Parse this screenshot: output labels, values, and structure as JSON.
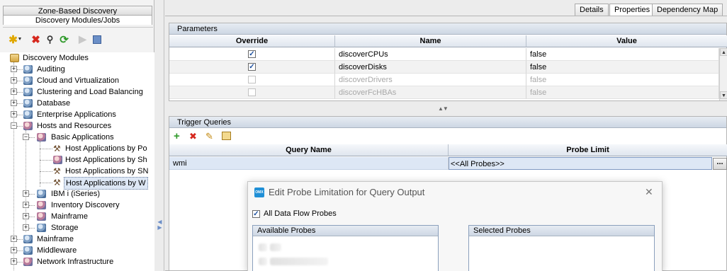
{
  "left_panel": {
    "tabs": [
      "Zone-Based Discovery",
      "Discovery Modules/Jobs"
    ],
    "toolbar": [
      {
        "name": "new",
        "icon": "new-star-icon"
      },
      {
        "name": "delete",
        "icon": "delete-x-icon"
      },
      {
        "name": "find",
        "icon": "search-icon"
      },
      {
        "name": "refresh",
        "icon": "refresh-icon"
      },
      {
        "name": "run",
        "icon": "play-icon"
      },
      {
        "name": "stop",
        "icon": "stop-icon"
      }
    ],
    "tree": {
      "root": "Discovery Modules",
      "items": [
        "Auditing",
        "Cloud and Virtualization",
        "Clustering and Load Balancing",
        "Database",
        "Enterprise Applications",
        "Hosts and Resources",
        "Basic Applications",
        "Host Applications by Po",
        "Host Applications by Sh",
        "Host Applications by SN",
        "Host Applications by W",
        "IBM i (iSeries)",
        "Inventory Discovery",
        "Mainframe",
        "Storage",
        "Mainframe",
        "Middleware",
        "Network Infrastructure"
      ]
    }
  },
  "right_panel": {
    "tabs": [
      "Details",
      "Properties",
      "Dependency Map"
    ],
    "active_tab": "Properties",
    "parameters": {
      "title": "Parameters",
      "columns": [
        "Override",
        "Name",
        "Value"
      ],
      "rows": [
        {
          "override": true,
          "name": "discoverCPUs",
          "value": "false",
          "enabled": true
        },
        {
          "override": true,
          "name": "discoverDisks",
          "value": "false",
          "enabled": true
        },
        {
          "override": false,
          "name": "discoverDrivers",
          "value": "false",
          "enabled": false
        },
        {
          "override": false,
          "name": "discoverFcHBAs",
          "value": "false",
          "enabled": false
        }
      ]
    },
    "trigger_queries": {
      "title": "Trigger Queries",
      "toolbar": [
        "add-icon",
        "remove-icon",
        "edit-icon",
        "preview-icon"
      ],
      "columns": [
        "Query Name",
        "Probe Limit"
      ],
      "rows": [
        {
          "query": "wmi",
          "probe_limit": "<<All Probes>>",
          "edit_button": "..."
        }
      ]
    }
  },
  "dialog": {
    "app_badge": "OMX",
    "title": "Edit Probe Limitation for Query Output",
    "close": "✕",
    "all_probes_label": "All Data Flow Probes",
    "all_probes_checked": true,
    "available_label": "Available Probes",
    "selected_label": "Selected Probes"
  },
  "colors": {
    "header_gradient_top": "#e7ecf3",
    "header_gradient_bottom": "#cdd7e4",
    "selection": "#dde7f5",
    "checkbox_mark": "#1c4f9e",
    "delete_red": "#d6281e",
    "refresh_green": "#2f9a2a"
  }
}
